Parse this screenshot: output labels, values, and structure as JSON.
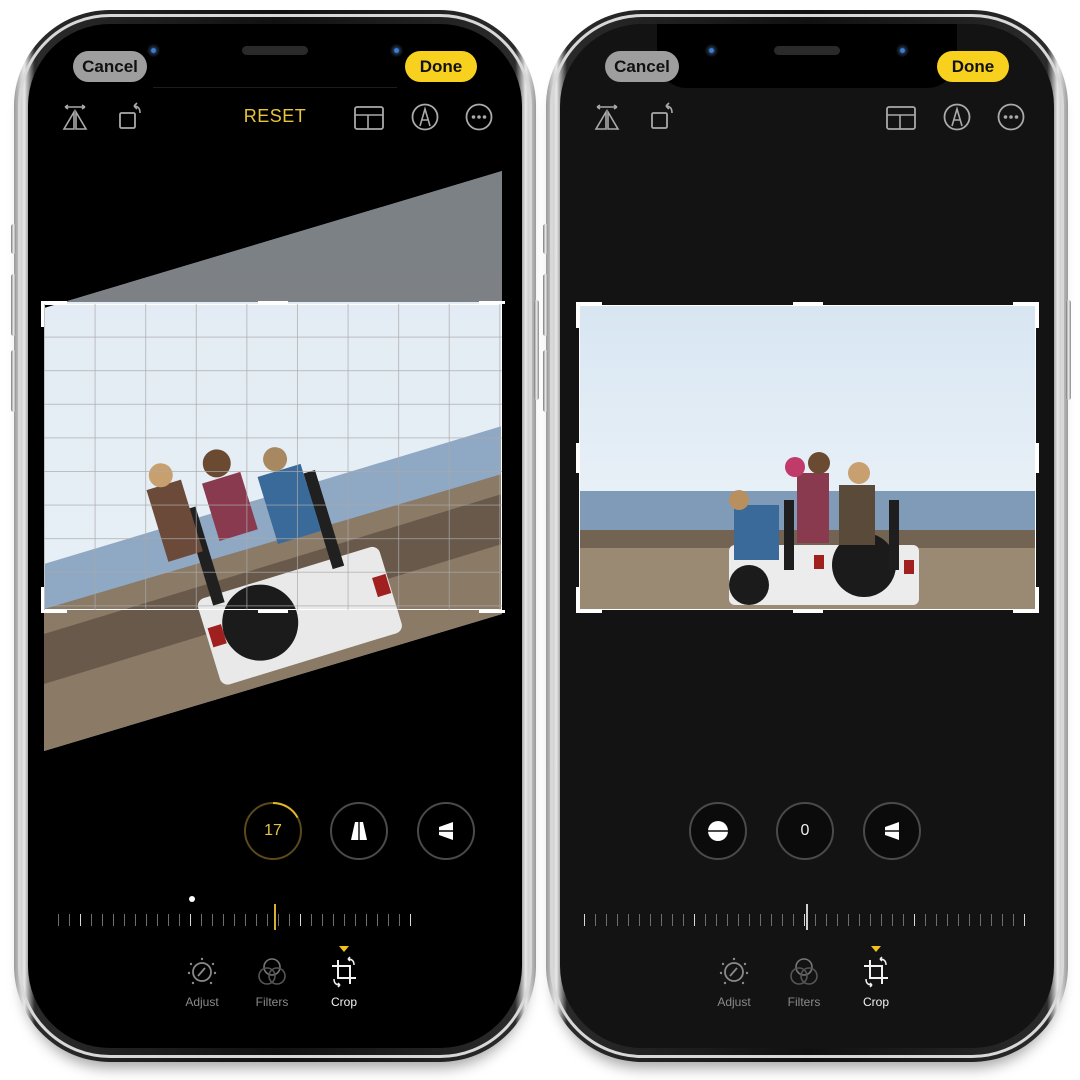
{
  "phones": [
    {
      "id": "left",
      "state": "straighten-adjusting",
      "header": {
        "cancel_label": "Cancel",
        "done_label": "Done",
        "reset_label": "RESET"
      },
      "toolbar_icons": [
        "flip-horizontal-icon",
        "rotate-icon",
        "aspect-ratio-icon",
        "markup-icon",
        "more-icon"
      ],
      "adjust_dials": [
        {
          "name": "straighten",
          "value": "17",
          "active": true,
          "progress": 0.17
        },
        {
          "name": "vertical-perspective",
          "icon": "vertical-perspective-icon",
          "active": false
        },
        {
          "name": "horizontal-perspective",
          "icon": "horizontal-perspective-icon",
          "active": false
        }
      ],
      "ruler": {
        "value": 17,
        "min": -45,
        "max": 45,
        "zero_marker": true
      },
      "tabs": [
        {
          "label": "Adjust",
          "icon": "adjust-dial-icon",
          "active": false
        },
        {
          "label": "Filters",
          "icon": "filters-icon",
          "active": false
        },
        {
          "label": "Crop",
          "icon": "crop-rotate-icon",
          "active": true
        }
      ],
      "photo": {
        "description": "Friends waving on a white jeep by the sea, rotated with crop grid"
      }
    },
    {
      "id": "right",
      "state": "straightened",
      "header": {
        "cancel_label": "Cancel",
        "done_label": "Done"
      },
      "toolbar_icons": [
        "flip-horizontal-icon",
        "rotate-icon",
        "aspect-ratio-icon",
        "markup-icon",
        "more-icon"
      ],
      "adjust_dials": [
        {
          "name": "straighten",
          "icon": "straighten-icon",
          "active": false
        },
        {
          "name": "vertical-perspective",
          "value": "0",
          "active": false
        },
        {
          "name": "horizontal-perspective",
          "icon": "horizontal-perspective-icon",
          "active": false
        }
      ],
      "ruler": {
        "value": 0,
        "min": -45,
        "max": 45
      },
      "tabs": [
        {
          "label": "Adjust",
          "icon": "adjust-dial-icon",
          "active": false
        },
        {
          "label": "Filters",
          "icon": "filters-icon",
          "active": false
        },
        {
          "label": "Crop",
          "icon": "crop-rotate-icon",
          "active": true
        }
      ],
      "photo": {
        "description": "Friends waving on a white jeep by the sea, level horizon"
      }
    }
  ],
  "colors": {
    "accent_yellow": "#f7d11e",
    "reset_text": "#e8c53a",
    "left_screen_bg": "#000000",
    "right_screen_bg": "#131313"
  }
}
